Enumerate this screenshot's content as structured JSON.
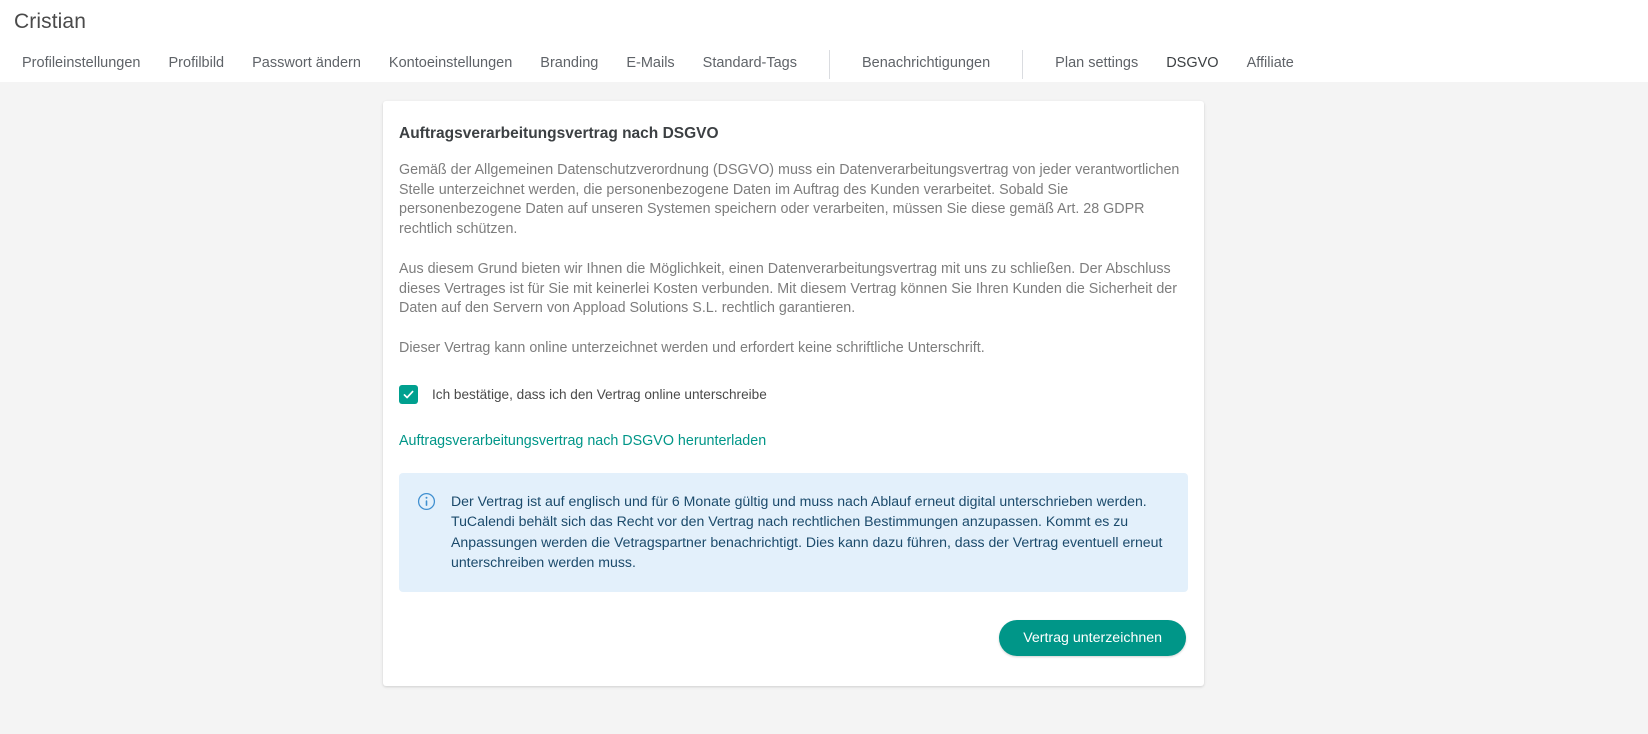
{
  "page": {
    "title": "Cristian"
  },
  "nav": {
    "group1": [
      {
        "label": "Profileinstellungen",
        "active": false
      },
      {
        "label": "Profilbild",
        "active": false
      },
      {
        "label": "Passwort ändern",
        "active": false
      },
      {
        "label": "Kontoeinstellungen",
        "active": false
      },
      {
        "label": "Branding",
        "active": false
      },
      {
        "label": "E-Mails",
        "active": false
      },
      {
        "label": "Standard-Tags",
        "active": false
      }
    ],
    "group2": [
      {
        "label": "Benachrichtigungen",
        "active": false
      }
    ],
    "group3": [
      {
        "label": "Plan settings",
        "active": false
      },
      {
        "label": "DSGVO",
        "active": true
      },
      {
        "label": "Affiliate",
        "active": false
      }
    ]
  },
  "card": {
    "title": "Auftragsverarbeitungsvertrag nach DSGVO",
    "paragraph1": "Gemäß der Allgemeinen Datenschutzverordnung (DSGVO) muss ein Datenverarbeitungsvertrag von jeder verantwortlichen Stelle unterzeichnet werden, die personenbezogene Daten im Auftrag des Kunden verarbeitet. Sobald Sie personenbezogene Daten auf unseren Systemen speichern oder verarbeiten, müssen Sie diese gemäß Art. 28 GDPR rechtlich schützen.",
    "paragraph2": "Aus diesem Grund bieten wir Ihnen die Möglichkeit, einen Datenverarbeitungsvertrag mit uns zu schließen. Der Abschluss dieses Vertrages ist für Sie mit keinerlei Kosten verbunden. Mit diesem Vertrag können Sie Ihren Kunden die Sicherheit der Daten auf den Servern von Appload Solutions S.L. rechtlich garantieren.",
    "paragraph3": "Dieser Vertrag kann online unterzeichnet werden und erfordert keine schriftliche Unterschrift.",
    "checkbox": {
      "label": "Ich bestätige, dass ich den Vertrag online unterschreibe",
      "checked": true
    },
    "download_link": "Auftragsverarbeitungsvertrag nach DSGVO herunterladen",
    "info": {
      "icon": "info-circle-icon",
      "text": "Der Vertrag ist auf englisch und für 6 Monate gültig und muss nach Ablauf erneut digital unterschrieben werden. TuCalendi behält sich das Recht vor den Vertrag nach rechtlichen Bestimmungen anzupassen. Kommt es zu Anpassungen werden die Vetragspartner benachrichtigt. Dies kann dazu führen, dass der Vertrag eventuell erneut unterschreiben werden muss."
    },
    "submit_button": "Vertrag unterzeichnen"
  },
  "colors": {
    "accent": "#009688",
    "checkbox": "#00a08f",
    "info_bg": "#e3f0fb",
    "info_text": "#1b4a6b",
    "page_bg": "#f4f4f4"
  }
}
